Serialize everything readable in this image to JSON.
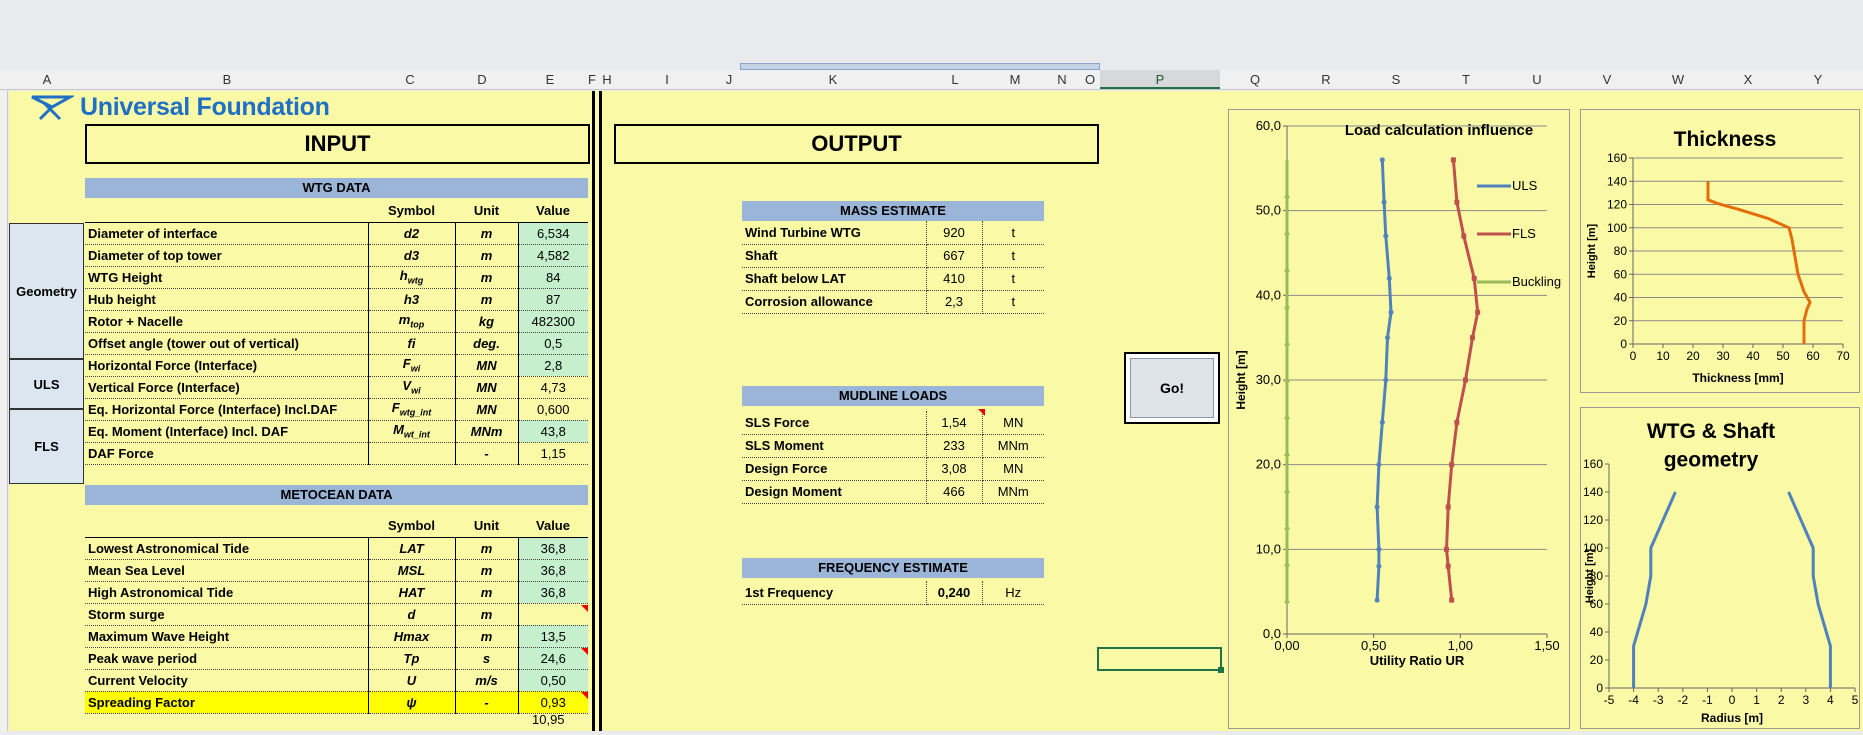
{
  "column_headers": [
    "A",
    "B",
    "C",
    "D",
    "E",
    "F",
    "H",
    "I",
    "J",
    "K",
    "L",
    "M",
    "N",
    "O",
    "P",
    "Q",
    "R",
    "S",
    "T",
    "U",
    "V",
    "W",
    "X",
    "Y"
  ],
  "logo": {
    "text": "Universal Foundation"
  },
  "input": {
    "title": "INPUT",
    "wtg_header": "WTG DATA",
    "col_symbol": "Symbol",
    "col_unit": "Unit",
    "col_value": "Value",
    "groups": {
      "geometry": "Geometry",
      "uls": "ULS",
      "fls": "FLS"
    },
    "rows": [
      {
        "name": "Diameter of interface",
        "sym": "d2",
        "unit": "m",
        "value": "6,534"
      },
      {
        "name": "Diameter of top tower",
        "sym": "d3",
        "unit": "m",
        "value": "4,582"
      },
      {
        "name": "WTG Height",
        "sym": "h",
        "sub": "wtg",
        "unit": "m",
        "value": "84"
      },
      {
        "name": "Hub height",
        "sym": "h3",
        "unit": "m",
        "value": "87"
      },
      {
        "name": "Rotor + Nacelle",
        "sym": "m",
        "sub": "top",
        "unit": "kg",
        "value": "482300"
      },
      {
        "name": "Offset angle (tower out of vertical)",
        "sym": "fi",
        "unit": "deg.",
        "value": "0,5"
      },
      {
        "name": "Horizontal Force (Interface)",
        "sym": "F",
        "sub": "wi",
        "unit": "MN",
        "value": "2,8"
      },
      {
        "name": "Vertical Force (Interface)",
        "sym": "V",
        "sub": "wi",
        "unit": "MN",
        "value": "4,73"
      },
      {
        "name": "Eq. Horizontal Force (Interface) Incl.DAF",
        "sym": "F",
        "sub": "wtg_int",
        "unit": "MN",
        "value": "0,600"
      },
      {
        "name": "Eq. Moment (Interface) Incl. DAF",
        "sym": "M",
        "sub": "wt_int",
        "unit": "MNm",
        "value": "43,8"
      },
      {
        "name": "DAF Force",
        "sym": "",
        "unit": "-",
        "value": "1,15"
      }
    ],
    "metocean_header": "METOCEAN DATA",
    "metocean_rows": [
      {
        "name": "Lowest Astronomical Tide",
        "sym": "LAT",
        "unit": "m",
        "value": "36,8"
      },
      {
        "name": "Mean Sea Level",
        "sym": "MSL",
        "unit": "m",
        "value": "36,8"
      },
      {
        "name": "High Astronomical Tide",
        "sym": "HAT",
        "unit": "m",
        "value": "36,8"
      },
      {
        "name": "Storm surge",
        "sym": "d",
        "unit": "m",
        "value": ""
      },
      {
        "name": "Maximum Wave Height",
        "sym": "Hmax",
        "unit": "m",
        "value": "13,5"
      },
      {
        "name": "Peak wave period",
        "sym": "Tp",
        "unit": "s",
        "value": "24,6"
      },
      {
        "name": "Current Velocity",
        "sym": "U",
        "unit": "m/s",
        "value": "0,50"
      },
      {
        "name": "Spreading Factor",
        "sym": "ψ",
        "unit": "-",
        "value": "0,93"
      }
    ],
    "extra_value": "10,95"
  },
  "output": {
    "title": "OUTPUT",
    "mass": {
      "header": "MASS ESTIMATE",
      "rows": [
        {
          "name": "Wind Turbine WTG",
          "value": "920",
          "unit": "t"
        },
        {
          "name": "Shaft",
          "value": "667",
          "unit": "t"
        },
        {
          "name": "Shaft below LAT",
          "value": "410",
          "unit": "t"
        },
        {
          "name": "Corrosion allowance",
          "value": "2,3",
          "unit": "t"
        }
      ]
    },
    "mudline": {
      "header": "MUDLINE LOADS",
      "rows": [
        {
          "name": "SLS Force",
          "value": "1,54",
          "unit": "MN"
        },
        {
          "name": "SLS Moment",
          "value": "233",
          "unit": "MNm"
        },
        {
          "name": "Design Force",
          "value": "3,08",
          "unit": "MN"
        },
        {
          "name": "Design Moment",
          "value": "466",
          "unit": "MNm"
        }
      ]
    },
    "frequency": {
      "header": "FREQUENCY ESTIMATE",
      "rows": [
        {
          "name": "1st Frequency",
          "value": "0,240",
          "unit": "Hz"
        }
      ]
    },
    "go_button": "Go!"
  },
  "chart_data": [
    {
      "type": "line",
      "title": "Load calculation influence",
      "xlabel": "Utility Ratio UR",
      "ylabel": "Height [m]",
      "xlim": [
        0,
        1.5
      ],
      "ylim": [
        0,
        60
      ],
      "xticks": [
        "0,00",
        "0,50",
        "1,00",
        "1,50"
      ],
      "yticks": [
        "0,0",
        "10,0",
        "20,0",
        "30,0",
        "40,0",
        "50,0",
        "60,0"
      ],
      "legend": "right",
      "series": [
        {
          "name": "ULS",
          "color": "#4f81bd",
          "points": [
            [
              0.52,
              4
            ],
            [
              0.53,
              8
            ],
            [
              0.53,
              10
            ],
            [
              0.52,
              15
            ],
            [
              0.53,
              20
            ],
            [
              0.55,
              25
            ],
            [
              0.57,
              30
            ],
            [
              0.58,
              35
            ],
            [
              0.6,
              38
            ],
            [
              0.59,
              42
            ],
            [
              0.57,
              47
            ],
            [
              0.56,
              51
            ],
            [
              0.55,
              56
            ]
          ]
        },
        {
          "name": "FLS",
          "color": "#c0504d",
          "points": [
            [
              0.95,
              4
            ],
            [
              0.93,
              8
            ],
            [
              0.92,
              10
            ],
            [
              0.93,
              15
            ],
            [
              0.95,
              20
            ],
            [
              0.98,
              25
            ],
            [
              1.03,
              30
            ],
            [
              1.07,
              35
            ],
            [
              1.1,
              38
            ],
            [
              1.08,
              42
            ],
            [
              1.02,
              47
            ],
            [
              0.98,
              51
            ],
            [
              0.96,
              56
            ]
          ]
        },
        {
          "name": "Buckling",
          "color": "#9bbb59",
          "points": [
            [
              0.0,
              4
            ],
            [
              0.0,
              56
            ]
          ]
        }
      ]
    },
    {
      "type": "line",
      "title": "Thickness",
      "xlabel": "Thickness [mm]",
      "ylabel": "Height [m]",
      "xlim": [
        0,
        70
      ],
      "ylim": [
        0,
        160
      ],
      "xticks": [
        "0",
        "10",
        "20",
        "30",
        "40",
        "50",
        "60",
        "70"
      ],
      "yticks": [
        "0",
        "20",
        "40",
        "60",
        "80",
        "100",
        "120",
        "140",
        "160"
      ],
      "series": [
        {
          "name": "",
          "color": "#e46c0a",
          "points": [
            [
              57,
              0
            ],
            [
              57,
              20
            ],
            [
              58,
              30
            ],
            [
              59,
              36
            ],
            [
              57,
              45
            ],
            [
              55,
              60
            ],
            [
              54,
              75
            ],
            [
              53,
              90
            ],
            [
              52,
              100
            ],
            [
              45,
              108
            ],
            [
              35,
              116
            ],
            [
              28,
              121
            ],
            [
              25,
              124
            ],
            [
              25,
              140
            ]
          ]
        }
      ]
    },
    {
      "type": "line",
      "title": "WTG & Shaft geometry",
      "xlabel": "Radius [m]",
      "ylabel": "Height [m]",
      "xlim": [
        -5,
        5
      ],
      "ylim": [
        0,
        160
      ],
      "xticks": [
        "-5",
        "-4",
        "-3",
        "-2",
        "-1",
        "0",
        "1",
        "2",
        "3",
        "4",
        "5"
      ],
      "yticks": [
        "0",
        "20",
        "40",
        "60",
        "80",
        "100",
        "120",
        "140",
        "160"
      ],
      "series": [
        {
          "name": "",
          "color": "#4f81bd",
          "points": [
            [
              -4,
              0
            ],
            [
              -4,
              30
            ],
            [
              -3.5,
              60
            ],
            [
              -3.3,
              80
            ],
            [
              -3.3,
              100
            ],
            [
              -2.3,
              140
            ]
          ]
        },
        {
          "name": "",
          "color": "#4f81bd",
          "points": [
            [
              4,
              0
            ],
            [
              4,
              30
            ],
            [
              3.5,
              60
            ],
            [
              3.3,
              80
            ],
            [
              3.3,
              100
            ],
            [
              2.3,
              140
            ]
          ]
        }
      ]
    }
  ]
}
